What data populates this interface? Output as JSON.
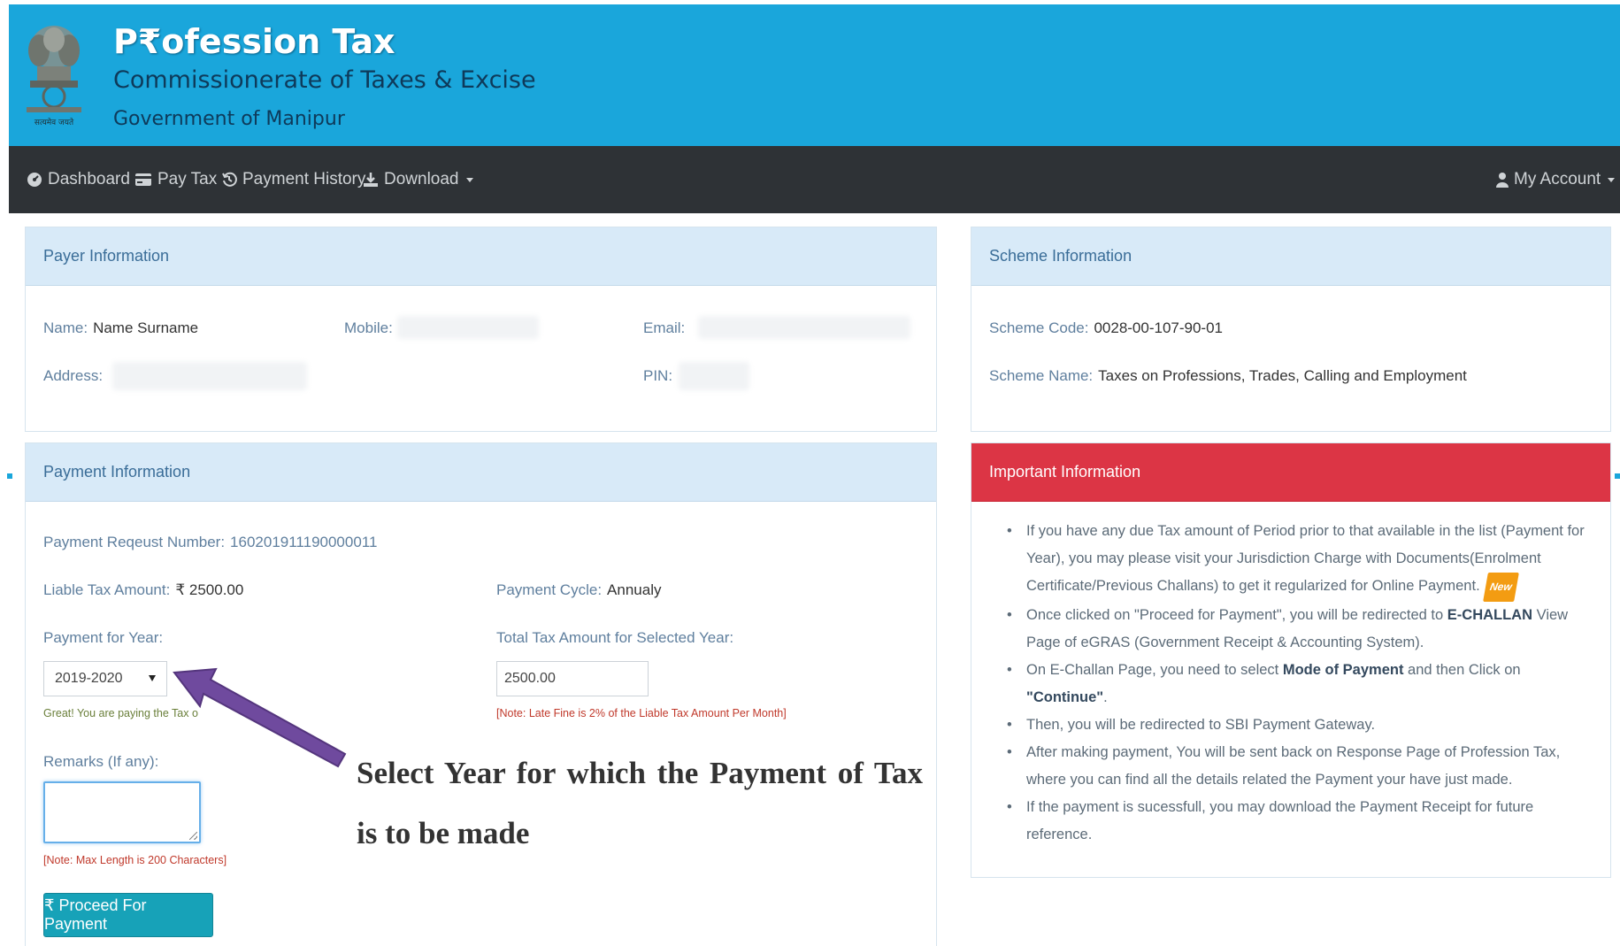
{
  "header": {
    "title": "P₹ofession Tax",
    "subtitle": "Commissionerate of Taxes & Excise",
    "government": "Government of Manipur",
    "emblem_caption": "सत्यमेव जयते"
  },
  "nav": {
    "dashboard": "Dashboard",
    "pay_tax": "Pay Tax",
    "payment_history": "Payment History",
    "download": "Download",
    "my_account": "My Account"
  },
  "payer": {
    "heading": "Payer Information",
    "name_label": "Name:",
    "name_value": "Name Surname",
    "mobile_label": "Mobile:",
    "email_label": "Email:",
    "address_label": "Address:",
    "pin_label": "PIN:"
  },
  "scheme": {
    "heading": "Scheme Information",
    "code_label": "Scheme Code:",
    "code_value": "0028-00-107-90-01",
    "name_label": "Scheme Name:",
    "name_value": "Taxes on Professions, Trades, Calling and Employment"
  },
  "payment": {
    "heading": "Payment Information",
    "request_label": "Payment Reqeust Number:",
    "request_value": "160201911190000011",
    "liable_label": "Liable Tax Amount:",
    "liable_value": "₹ 2500.00",
    "cycle_label": "Payment Cycle:",
    "cycle_value": "Annualy",
    "year_label": "Payment for Year:",
    "year_value": "2019-2020",
    "total_label": "Total Tax Amount for Selected Year:",
    "total_value": "2500.00",
    "year_note": "Great! You are paying the Tax on time",
    "late_note": "[Note: Late Fine is 2% of the Liable Tax Amount Per Month]",
    "remarks_label": "Remarks (If any):",
    "remarks_value": "",
    "remarks_note": "[Note: Max Length is 200 Characters]",
    "proceed_button": "₹ Proceed For Payment"
  },
  "important": {
    "heading": "Important Information",
    "item1": "If you have any due Tax amount of Period prior to that available in the list (Payment for Year), you may please visit your Jurisdiction Charge with Documents(Enrolment Certificate/Previous Challans) to get it regularized for Online Payment.",
    "new_badge": "New",
    "item2_a": "Once clicked on \"Proceed for Payment\", you will be redirected to ",
    "item2_b": "E-CHALLAN",
    "item2_c": " View Page of eGRAS (Government Receipt & Accounting System).",
    "item3_a": "On E-Challan Page, you need to select ",
    "item3_b": "Mode of Payment",
    "item3_c": " and then Click on ",
    "item3_d": "\"Continue\"",
    "item3_e": ".",
    "item4": "Then, you will be redirected to SBI Payment Gateway.",
    "item5": "After making payment, You will be sent back on Response Page of Profession Tax, where you can find all the details related the Payment your have just made.",
    "item6": "If the payment is sucessfull, you may download the Payment Receipt for future reference."
  },
  "annotation": {
    "text": "Select Year for which the Payment of Tax is to be made"
  },
  "colors": {
    "header_bg": "#1aa6db",
    "nav_bg": "#2e3236",
    "panel_head_bg": "#d8eaf8",
    "danger": "#dc3545",
    "button": "#17a2b8",
    "arrow": "#6f4a9e"
  },
  "icons": [
    "emblem-icon",
    "dashboard-icon",
    "pay-tax-icon",
    "history-icon",
    "download-icon",
    "user-icon",
    "rupee-icon"
  ]
}
